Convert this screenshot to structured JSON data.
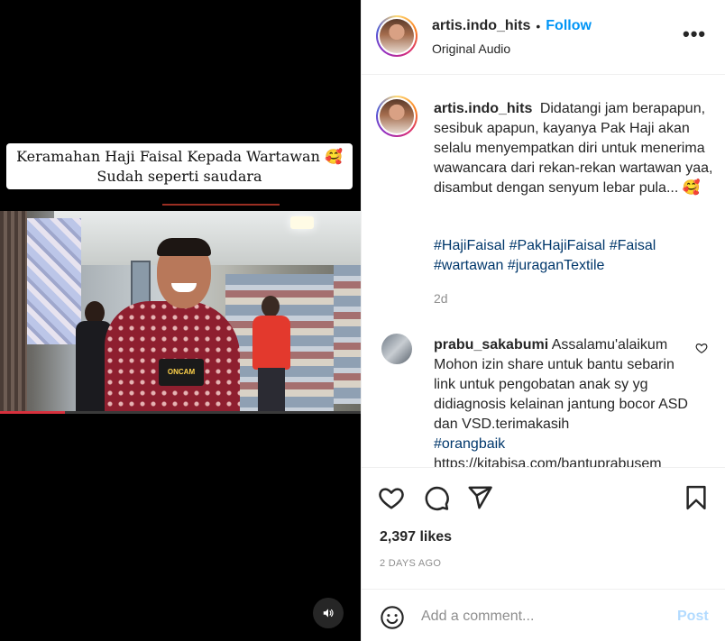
{
  "video": {
    "overlay_line1": "Keramahan Haji Faisal Kepada Wartawan 🥰",
    "overlay_line2": "Sudah seperti saudara",
    "badge_text": "ONCAM",
    "audio_icon": "speaker-icon",
    "progress_fraction": 0.18
  },
  "header": {
    "username": "artis.indo_hits",
    "dot": "•",
    "follow_label": "Follow",
    "subtitle": "Original Audio",
    "more_icon": "more-options-icon",
    "more_label": "•••"
  },
  "post": {
    "username": "artis.indo_hits",
    "caption": "Didatangi jam berapapun, sesibuk apapun, kayanya Pak Haji akan selalu menyempatkan diri untuk menerima wawancara dari rekan-rekan wartawan yaa, disambut dengan senyum lebar pula... 🥰",
    "hashtags": "#HajiFaisal #PakHajiFaisal #Faisal #wartawan #juraganTextile",
    "age": "2d"
  },
  "comment": {
    "username": "prabu_sakabumi",
    "text": "Assalamu'alaikum Mohon izin share untuk bantu sebarin link untuk pengobatan anak sy yg didiagnosis kelainan jantung bocor ASD dan VSD.terimakasih",
    "hashtag": "#orangbaik",
    "link": "https://kitabisa.com/bantuprabusem"
  },
  "actions": {
    "like_icon": "heart-icon",
    "comment_icon": "comment-icon",
    "share_icon": "send-icon",
    "save_icon": "bookmark-icon",
    "likes": "2,397 likes",
    "date": "2 DAYS AGO"
  },
  "add_comment": {
    "emoji_icon": "emoji-icon",
    "placeholder": "Add a comment...",
    "post_label": "Post"
  },
  "colors": {
    "link_blue": "#0095f6",
    "hashtag": "#00376b",
    "post_disabled": "#b3dbff"
  }
}
